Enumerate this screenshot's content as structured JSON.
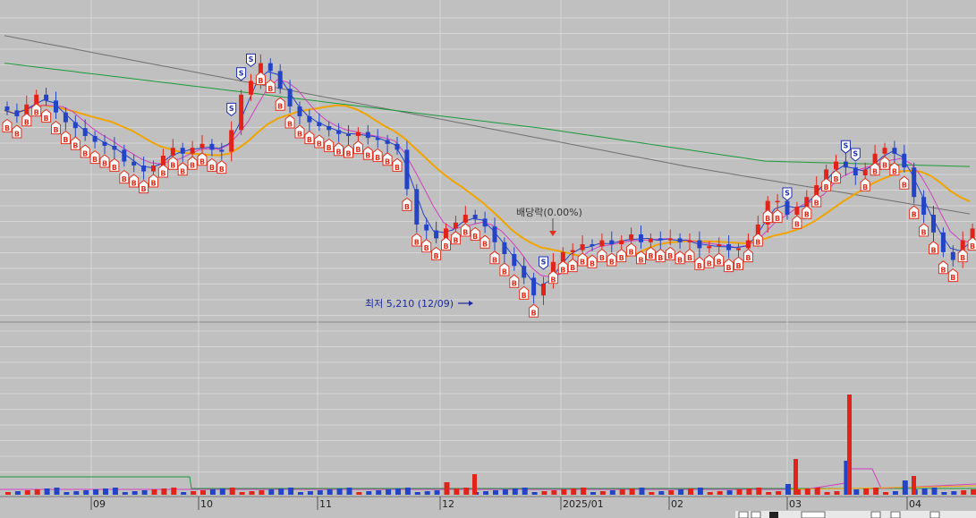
{
  "colors": {
    "background": "#c0c0c0",
    "grid": "#d6d6d6",
    "up": "#e2231a",
    "down": "#2444c8",
    "ma5": "#d040c0",
    "ma20": "#f0a400",
    "ma60": "#1a9a3a",
    "ma120": "#707070",
    "buy_marker": "#e0301e",
    "sell_marker": "#1c2fb0"
  },
  "chart_data": {
    "type": "candlestick",
    "x_ticks": [
      "09",
      "10",
      "11",
      "12",
      "2025/01",
      "02",
      "03",
      "04"
    ],
    "grid": true,
    "series": [
      {
        "name": "price",
        "kind": "ohlc",
        "close_path": [
          6180,
          6150,
          6210,
          6260,
          6230,
          6170,
          6120,
          6090,
          6050,
          6020,
          6000,
          5980,
          5920,
          5900,
          5870,
          5900,
          5950,
          5990,
          5960,
          5990,
          6010,
          5980,
          5970,
          6080,
          6260,
          6330,
          6420,
          6380,
          6290,
          6200,
          6150,
          6120,
          6100,
          6080,
          6060,
          6050,
          6070,
          6040,
          6030,
          6010,
          5980,
          5780,
          5600,
          5570,
          5530,
          5580,
          5610,
          5650,
          5630,
          5590,
          5510,
          5450,
          5390,
          5330,
          5240,
          5300,
          5410,
          5460,
          5470,
          5500,
          5490,
          5520,
          5500,
          5520,
          5550,
          5510,
          5530,
          5520,
          5530,
          5510,
          5520,
          5480,
          5490,
          5500,
          5470,
          5480,
          5520,
          5600,
          5720,
          5720,
          5650,
          5690,
          5740,
          5800,
          5880,
          5920,
          5890,
          5850,
          5880,
          5960,
          5990,
          5960,
          5890,
          5740,
          5650,
          5560,
          5460,
          5420,
          5520,
          5580
        ]
      },
      {
        "name": "volume",
        "kind": "bar",
        "notable": [
          {
            "label": "03",
            "value": 9.1
          },
          {
            "label": "12",
            "value": 1.6
          }
        ]
      }
    ],
    "markers": {
      "buy": "B",
      "sell": "S"
    },
    "annotations": [
      {
        "text": "최저 5,210 (12/09)",
        "kind": "low"
      },
      {
        "text": "배당락(0.00%)",
        "kind": "ex-dividend"
      }
    ]
  },
  "labels": {
    "low_annotation": "최저 5,210 (12/09)",
    "dividend_annotation": "배당락(0.00%)",
    "buy_glyph": "B",
    "sell_glyph": "S"
  }
}
